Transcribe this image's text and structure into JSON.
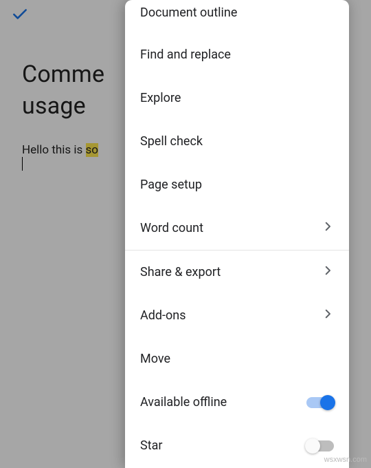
{
  "topbar": {
    "confirm_icon": "check"
  },
  "document": {
    "title_line1": "Comme",
    "title_line2": "usage",
    "body_prefix": "Hello this is ",
    "body_highlight": "so"
  },
  "menu": {
    "items": [
      {
        "label": "Document outline",
        "chevron": false,
        "toggle": null
      },
      {
        "label": "Find and replace",
        "chevron": false,
        "toggle": null
      },
      {
        "label": "Explore",
        "chevron": false,
        "toggle": null
      },
      {
        "label": "Spell check",
        "chevron": false,
        "toggle": null
      },
      {
        "label": "Page setup",
        "chevron": false,
        "toggle": null
      },
      {
        "label": "Word count",
        "chevron": true,
        "toggle": null
      },
      {
        "label": "Share & export",
        "chevron": true,
        "toggle": null
      },
      {
        "label": "Add-ons",
        "chevron": true,
        "toggle": null
      },
      {
        "label": "Move",
        "chevron": false,
        "toggle": null
      },
      {
        "label": "Available offline",
        "chevron": false,
        "toggle": "on"
      },
      {
        "label": "Star",
        "chevron": false,
        "toggle": "off"
      }
    ],
    "divider_after_index": 5
  },
  "watermark": "wsxwsn.com"
}
